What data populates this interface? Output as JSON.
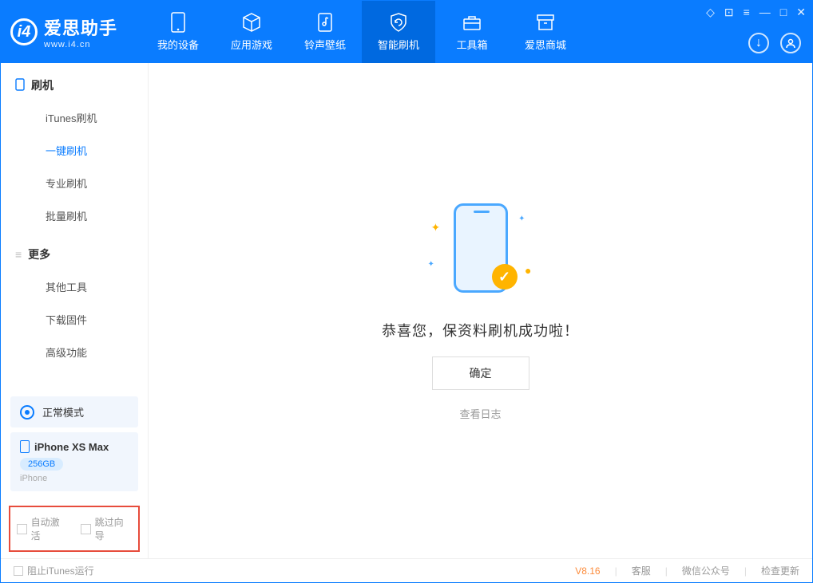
{
  "logo": {
    "name": "爱思助手",
    "url": "www.i4.cn",
    "mark": "i4"
  },
  "nav": [
    {
      "label": "我的设备"
    },
    {
      "label": "应用游戏"
    },
    {
      "label": "铃声壁纸"
    },
    {
      "label": "智能刷机"
    },
    {
      "label": "工具箱"
    },
    {
      "label": "爱思商城"
    }
  ],
  "sidebar": {
    "section1_title": "刷机",
    "items1": [
      {
        "label": "iTunes刷机"
      },
      {
        "label": "一键刷机"
      },
      {
        "label": "专业刷机"
      },
      {
        "label": "批量刷机"
      }
    ],
    "section2_title": "更多",
    "items2": [
      {
        "label": "其他工具"
      },
      {
        "label": "下载固件"
      },
      {
        "label": "高级功能"
      }
    ],
    "mode_label": "正常模式",
    "device": {
      "name": "iPhone XS Max",
      "storage": "256GB",
      "type": "iPhone"
    },
    "checks": {
      "auto_activate": "自动激活",
      "skip_guide": "跳过向导"
    }
  },
  "main": {
    "success_msg": "恭喜您，保资料刷机成功啦！",
    "ok_label": "确定",
    "view_log": "查看日志"
  },
  "footer": {
    "block_itunes": "阻止iTunes运行",
    "version": "V8.16",
    "support": "客服",
    "wechat": "微信公众号",
    "check_update": "检查更新"
  }
}
